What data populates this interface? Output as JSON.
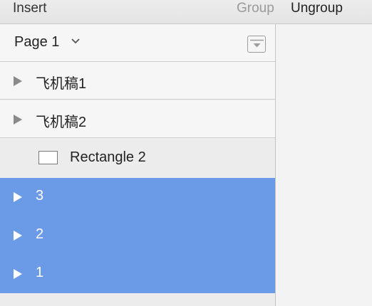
{
  "toolbar": {
    "insert_label": "Insert",
    "group_label": "Group",
    "ungroup_label": "Ungroup"
  },
  "layers_panel": {
    "page_title": "Page 1",
    "layers": [
      {
        "name": "飞机稿1",
        "type": "group",
        "selected": false
      },
      {
        "name": "飞机稿2",
        "type": "group",
        "selected": false
      },
      {
        "name": "Rectangle 2",
        "type": "rectangle",
        "selected": false
      },
      {
        "name": "3",
        "type": "group",
        "selected": true
      },
      {
        "name": "2",
        "type": "group",
        "selected": true
      },
      {
        "name": "1",
        "type": "group",
        "selected": true
      }
    ]
  },
  "colors": {
    "selection": "#6b9be6",
    "panel_bg": "#f6f6f6",
    "toolbar_disabled_text": "#9a9a9a"
  },
  "icons": {
    "page_dropdown": "chevron-down-icon",
    "collapse": "collapse-panel-icon",
    "disclosure": "disclosure-triangle-icon",
    "rectangle": "rectangle-shape-icon"
  }
}
